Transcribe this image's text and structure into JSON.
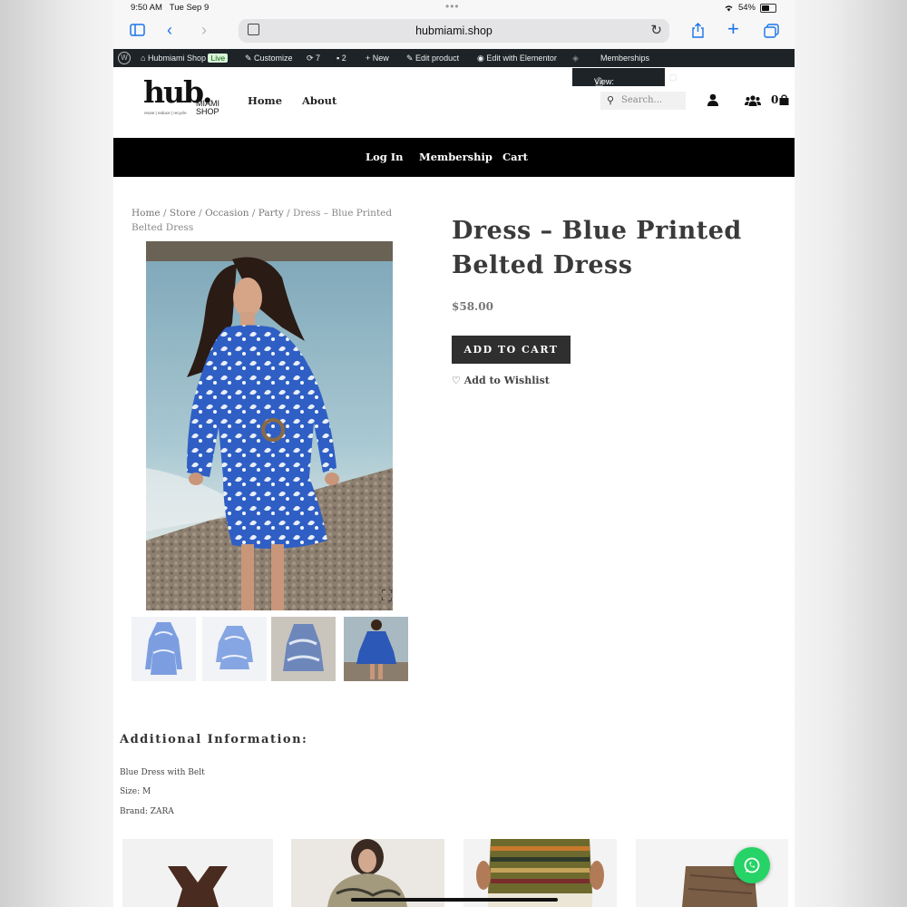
{
  "status_bar": {
    "time": "9:50 AM",
    "date": "Tue Sep 9",
    "battery": "54%"
  },
  "browser": {
    "url": "hubmiami.shop"
  },
  "admin_bar": {
    "site": "Hubmiami Shop",
    "live_badge": "Live",
    "customize": "Customize",
    "updates_count": "7",
    "comments_count": "2",
    "new": "New",
    "edit_product": "Edit product",
    "edit_elementor": "Edit with Elementor",
    "memberships": "Memberships",
    "tooltip": "View: My Access"
  },
  "header": {
    "logo_main": "hub.",
    "logo_sub_1": "MIAMI",
    "logo_sub_2": "SHOP",
    "logo_tagline": "reuse | reduce | recycle",
    "nav": [
      "Home",
      "About"
    ],
    "search_placeholder": "Search...",
    "cart_count": "0"
  },
  "secondary_nav": [
    "Log In",
    "Membership",
    "Cart"
  ],
  "breadcrumb": {
    "items": [
      "Home",
      "Store",
      "Occasion",
      "Party"
    ],
    "current": "Dress – Blue Printed Belted Dress"
  },
  "product": {
    "title": "Dress – Blue Printed Belted Dress",
    "price": "$58.00",
    "add_to_cart": "ADD TO CART",
    "wishlist": "Add to Wishlist"
  },
  "additional_info": {
    "heading": "Additional Information:",
    "lines": [
      "Blue Dress with Belt",
      "Size: M",
      "Brand: ZARA"
    ]
  },
  "colors": {
    "black_bar": "#000000",
    "button": "#2f2f2f",
    "whatsapp": "#25d366",
    "dress_blue": "#2f5fc4"
  }
}
